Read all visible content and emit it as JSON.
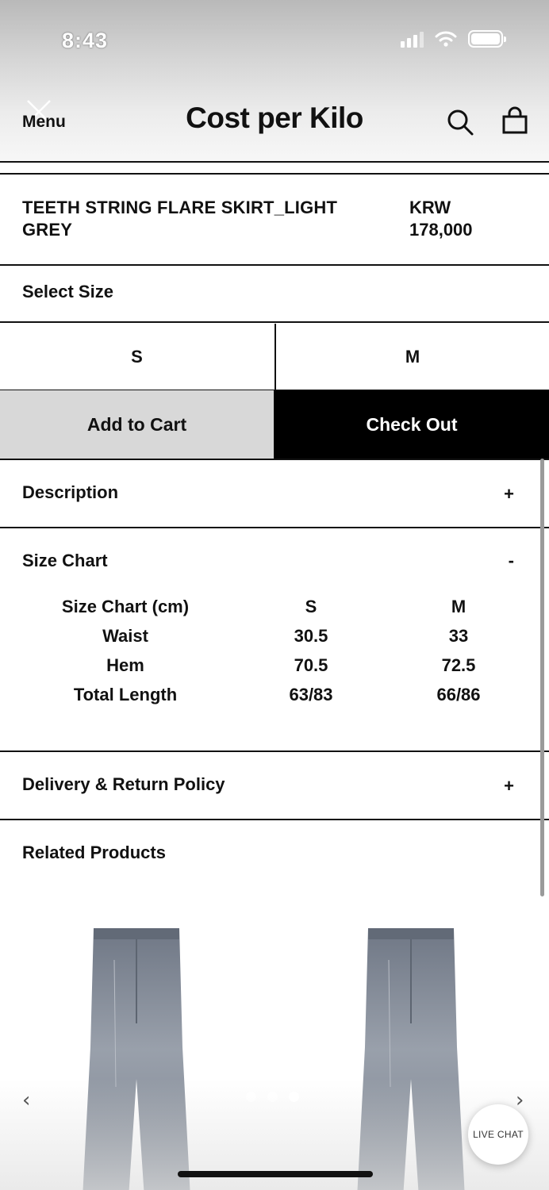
{
  "status_bar": {
    "time": "8:43"
  },
  "header": {
    "menu_label": "Menu",
    "brand": "Cost per Kilo"
  },
  "product": {
    "name": "TEETH STRING FLARE SKIRT_LIGHT GREY",
    "currency": "KRW",
    "price": "178,000"
  },
  "size_select": {
    "label": "Select Size",
    "options": [
      "S",
      "M"
    ]
  },
  "actions": {
    "add_to_cart": "Add to Cart",
    "check_out": "Check Out"
  },
  "accordions": {
    "description": {
      "title": "Description",
      "toggle": "+"
    },
    "size_chart": {
      "title": "Size Chart",
      "toggle": "-"
    },
    "delivery": {
      "title": "Delivery & Return Policy",
      "toggle": "+"
    }
  },
  "size_chart_table": {
    "header": [
      "Size Chart (cm)",
      "S",
      "M"
    ],
    "rows": [
      [
        "Waist",
        "30.5",
        "33"
      ],
      [
        "Hem",
        "70.5",
        "72.5"
      ],
      [
        "Total Length",
        "63/83",
        "66/86"
      ]
    ]
  },
  "related": {
    "title": "Related Products",
    "prev_glyph": "‹",
    "next_glyph": "›",
    "slide_count": 3,
    "active_slide": 3
  },
  "live_chat": {
    "label": "LIVE CHAT"
  },
  "colors": {
    "accent": "#000000",
    "cart_button": "#d8d8d8",
    "denim": "#7d8592"
  }
}
